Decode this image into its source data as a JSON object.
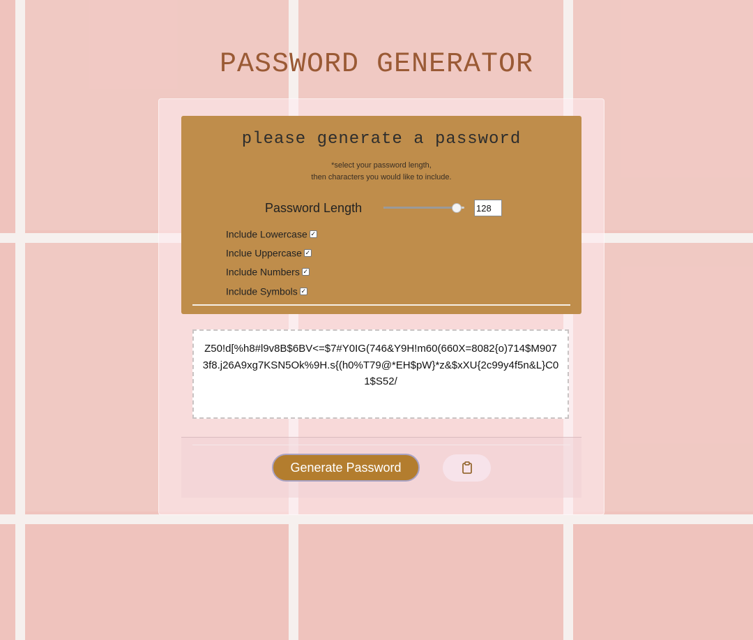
{
  "page": {
    "title": "PASSWORD GENERATOR"
  },
  "card": {
    "heading": "please generate a password",
    "note_line1": "*select your password length,",
    "note_line2": "then characters you would like to include.",
    "length_label": "Password Length",
    "length_value": "128",
    "length_fraction": 0.9,
    "options": [
      {
        "label": "Include Lowercase",
        "checked": true
      },
      {
        "label": "Inclue Uppercase",
        "checked": true
      },
      {
        "label": "Include Numbers",
        "checked": true
      },
      {
        "label": "Include Symbols",
        "checked": true
      }
    ],
    "password": "Z50!d[%h8#l9v8B$6BV<=$7#Y0IG(746&Y9H!m60(660X=8082{o)714$M9073f8.j26A9xg7KSN5Ok%9H.s{(h0%T79@*EH$pW}*z&$xXU{2c99y4f5n&L}C01$S52/",
    "generate_button": "Generate Password",
    "copy_icon": "clipboard-icon"
  },
  "colors": {
    "background": "#efc3bd",
    "title": "#9a5a35",
    "panel": "#bf8d4b",
    "button": "#b37d2e",
    "copy_button": "#f7e3ea"
  }
}
